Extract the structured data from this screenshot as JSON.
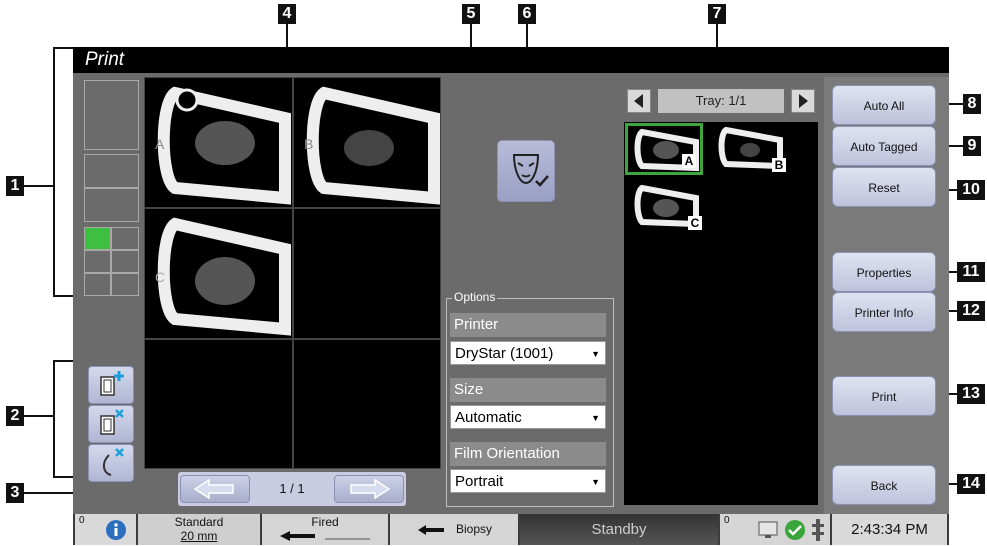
{
  "window": {
    "title": "Print"
  },
  "callouts": [
    "1",
    "2",
    "3",
    "4",
    "5",
    "6",
    "7",
    "8",
    "9",
    "10",
    "11",
    "12",
    "13",
    "14"
  ],
  "pager": {
    "page": "1 / 1"
  },
  "options": {
    "legend": "Options",
    "printer_label": "Printer",
    "printer_value": "DryStar (1001)",
    "size_label": "Size",
    "size_value": "Automatic",
    "orientation_label": "Film Orientation",
    "orientation_value": "Portrait"
  },
  "tray": {
    "label": "Tray: 1/1",
    "thumbs": [
      "A",
      "B",
      "C"
    ]
  },
  "buttons": {
    "auto_all": "Auto All",
    "auto_tagged": "Auto Tagged",
    "reset": "Reset",
    "properties": "Properties",
    "printer_info": "Printer Info",
    "print": "Print",
    "back": "Back"
  },
  "film": {
    "letters": [
      "A",
      "B",
      "C"
    ]
  },
  "statusbar": {
    "badge_left": "0",
    "paddle": "Standard",
    "paddle_size": "20 mm",
    "fired": "Fired",
    "biopsy": "Biopsy",
    "standby": "Standby",
    "badge_right": "0",
    "time": "2:43:34 PM"
  },
  "colors": {
    "selected_thumb": "#3fa63f",
    "layout_selected": "#3fbf3f"
  }
}
